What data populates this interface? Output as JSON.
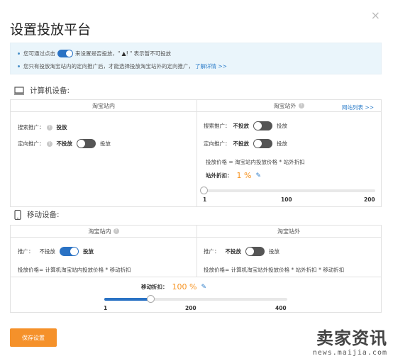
{
  "dialog": {
    "title": "设置投放平台",
    "close": "×"
  },
  "tips": {
    "line1_a": "您可通过点击",
    "line1_b": "来设置是否投放，\"",
    "line1_c": "\" 表示暂不可投放",
    "line2": "您只有投放淘宝站内的定向推广后，才能选择投放淘宝站外的定向推广，",
    "line2_link": "了解详情 >>"
  },
  "pc": {
    "title": "计算机设备:",
    "inside": {
      "header": "淘宝站内",
      "search_label": "搜索推广：",
      "search_value": "投放",
      "target_label": "定向推广：",
      "target_off": "不投放",
      "target_on": "投放"
    },
    "outside": {
      "header": "淘宝站外",
      "site_list_link": "网站列表 >>",
      "search_label": "搜索推广：",
      "search_off": "不投放",
      "search_on": "投放",
      "target_label": "定向推广：",
      "target_off": "不投放",
      "target_on": "投放",
      "price_formula": "投放价格 = 淘宝站内投放价格 * 站外折扣",
      "discount_label": "站外折扣：",
      "discount_value": "1 %",
      "slider": {
        "min": "1",
        "mid": "100",
        "max": "200",
        "value_fraction": 0.0
      }
    }
  },
  "mobile": {
    "title": "移动设备:",
    "inside": {
      "header": "淘宝站内",
      "promo_label": "推广：",
      "off": "不投放",
      "on": "投放",
      "formula": "投放价格= 计算机淘宝站内投放价格 * 移动折扣"
    },
    "outside": {
      "header": "淘宝站外",
      "promo_label": "推广：",
      "off": "不投放",
      "on": "投放",
      "formula": "投放价格= 计算机淘宝站外投放价格 * 站外折扣 * 移动折扣"
    },
    "discount_label": "移动折扣：",
    "discount_value": "100 %",
    "slider": {
      "min": "1",
      "mid": "200",
      "max": "400",
      "value_fraction": 0.25
    }
  },
  "save_button": "保存设置",
  "watermark": {
    "cn": "卖家资讯",
    "en": "news.maijia.com"
  },
  "colors": {
    "accent": "#2a72c4",
    "orange": "#f5912a",
    "tip_bg": "#eaf5fb"
  }
}
